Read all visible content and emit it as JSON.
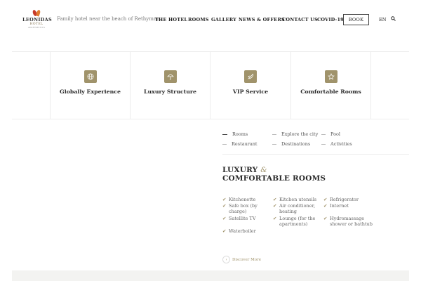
{
  "brand": {
    "name": "LEONIDAS",
    "sub": "HOTEL",
    "tiny": "APARTMENTS",
    "tagline": "Family hotel near the beach of Rethymno"
  },
  "nav": {
    "items": [
      "THE HOTEL",
      "ROOMS",
      "GALLERY",
      "NEWS & OFFERS",
      "CONTACT US",
      "COVID-19"
    ],
    "book_label": "BOOK",
    "lang": "EN"
  },
  "features": [
    {
      "title": "Globally Experience",
      "icon": "globe-icon"
    },
    {
      "title": "Luxury Structure",
      "icon": "umbrella-icon"
    },
    {
      "title": "VIP Service",
      "icon": "rocket-icon"
    },
    {
      "title": "Comfortable Rooms",
      "icon": "star-icon"
    }
  ],
  "tabs": [
    "Rooms",
    "Explore the city",
    "Pool",
    "Restaurant",
    "Destinations",
    "Activities"
  ],
  "section": {
    "title_line1": "LUXURY",
    "amp": "&",
    "title_line2": "COMFORTABLE ROOMS"
  },
  "amenities": [
    "Kitchenette",
    "Kitchen utensils",
    "Refrigerator",
    "Safe box (by charge)",
    "Air conditioner, heating",
    "Internet",
    "Satellite TV",
    "Lounge (for the apartments)",
    "Hydromassage shower or bathtub",
    "Waterboiler"
  ],
  "discover_label": "Discover More",
  "colors": {
    "accent": "#a0936b",
    "text": "#2a2a2a",
    "divider": "#ececec"
  }
}
